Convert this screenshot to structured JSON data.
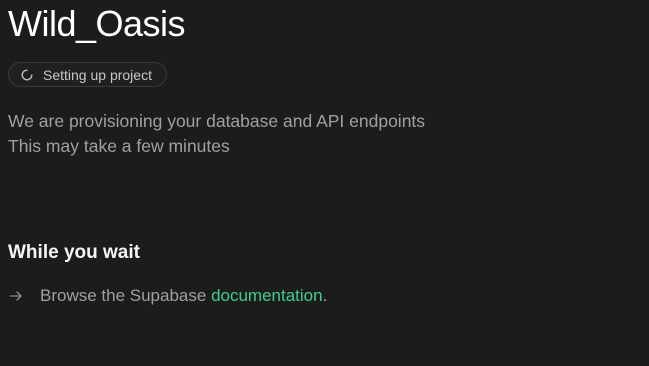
{
  "project": {
    "name": "Wild_Oasis",
    "status": "Setting up project"
  },
  "description": {
    "line1": "We are provisioning your database and API endpoints",
    "line2": "This may take a few minutes"
  },
  "wait_section": {
    "heading": "While you wait",
    "items": [
      {
        "prefix": "Browse the Supabase ",
        "link_text": "documentation",
        "suffix": "."
      }
    ]
  },
  "icons": {
    "status": "spinner-icon",
    "list_bullet": "arrow-right-icon"
  },
  "colors": {
    "background": "#1c1c1c",
    "accent_link": "#3ecf8e"
  }
}
